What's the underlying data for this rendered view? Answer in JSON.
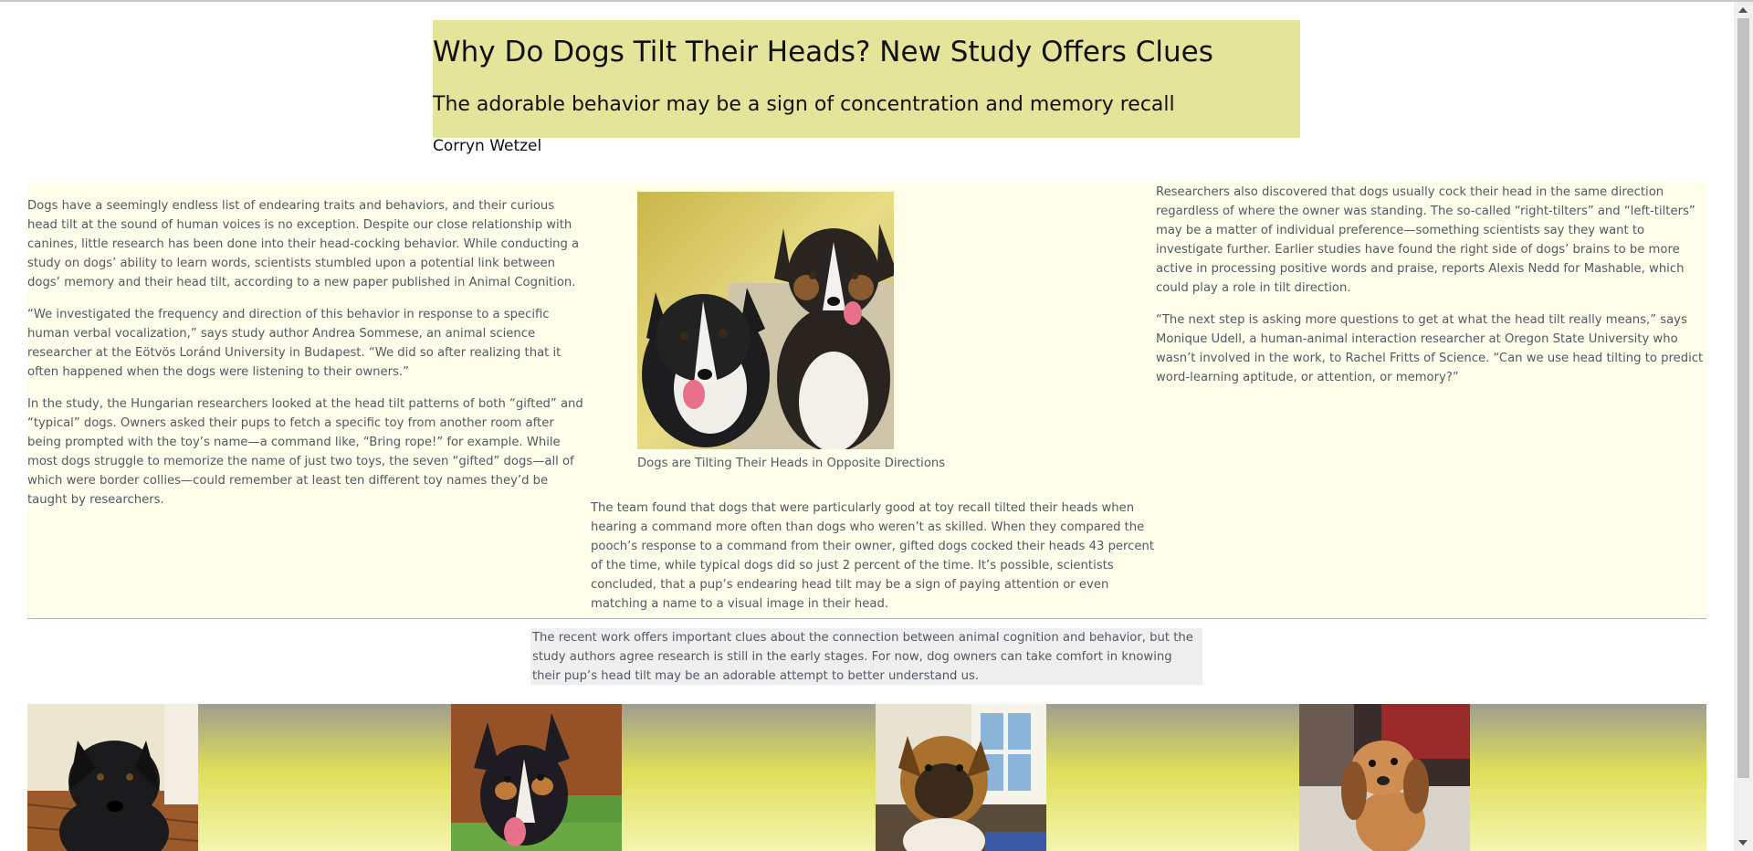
{
  "header": {
    "title": "Why Do Dogs Tilt Their Heads? New Study Offers Clues",
    "subtitle": "The adorable behavior may be a sign of concentration and memory recall",
    "author": "Corryn Wetzel"
  },
  "article": {
    "col1": [
      "Dogs have a seemingly endless list of endearing traits and behaviors, and their curious head tilt at the sound of human voices is no exception. Despite our close relationship with canines, little research has been done into their head-cocking behavior. While conducting a study on dogs’ ability to learn words, scientists stumbled upon a potential link between dogs’ memory and their head tilt, according to a new paper published in Animal Cognition.",
      "“We investigated the frequency and direction of this behavior in response to a specific human verbal vocalization,” says study author Andrea Sommese, an animal science researcher at the Eötvös Loránd University in Budapest. “We did so after realizing that it often happened when the dogs were listening to their owners.”",
      "In the study, the Hungarian researchers looked at the head tilt patterns of both “gifted” and “typical” dogs. Owners asked their pups to fetch a specific toy from another room after being prompted with the toy’s name—a command like, “Bring rope!” for example. While most dogs struggle to memorize the name of just two toys, the seven “gifted” dogs—all of which were border collies—could remember at least ten different toy names they’d be taught by researchers."
    ],
    "figure_caption": "Dogs are Tilting Their Heads in Opposite Directions",
    "col2": "The team found that dogs that were particularly good at toy recall tilted their heads when hearing a command more often than dogs who weren’t as skilled. When they compared the pooch’s response to a command from their owner, gifted dogs cocked their heads 43 percent of the time, while typical dogs did so just 2 percent of the time. It’s possible, scientists concluded, that a pup’s endearing head tilt may be a sign of paying attention or even matching a name to a visual image in their head.",
    "col3": [
      "Researchers also discovered that dogs usually cock their head in the same direction regardless of where the owner was standing. The so-called “right-tilters” and “left-tilters” may be a matter of individual preference—something scientists say they want to investigate further. Earlier studies have found the right side of dogs’ brains to be more active in processing positive words and praise, reports Alexis Nedd for Mashable, which could play a role in tilt direction.",
      "“The next step is asking more questions to get at what the head tilt really means,” says Monique Udell, a human-animal interaction researcher at Oregon State University who wasn’t involved in the work, to Rachel Fritts of Science. “Can we use head tilting to predict word-learning aptitude, or attention, or memory?”"
    ]
  },
  "conclusion": "The recent work offers important clues about the connection between animal cognition and behavior, but the study authors agree research is still in the early stages. For now, dog owners can take comfort in knowing their pup’s head tilt may be an adorable attempt to better understand us.",
  "colors": {
    "header_bg": "#e4e49b",
    "article_bg": "#fefeeb",
    "conclusion_bg": "#efefef",
    "body_text": "#505a64"
  }
}
